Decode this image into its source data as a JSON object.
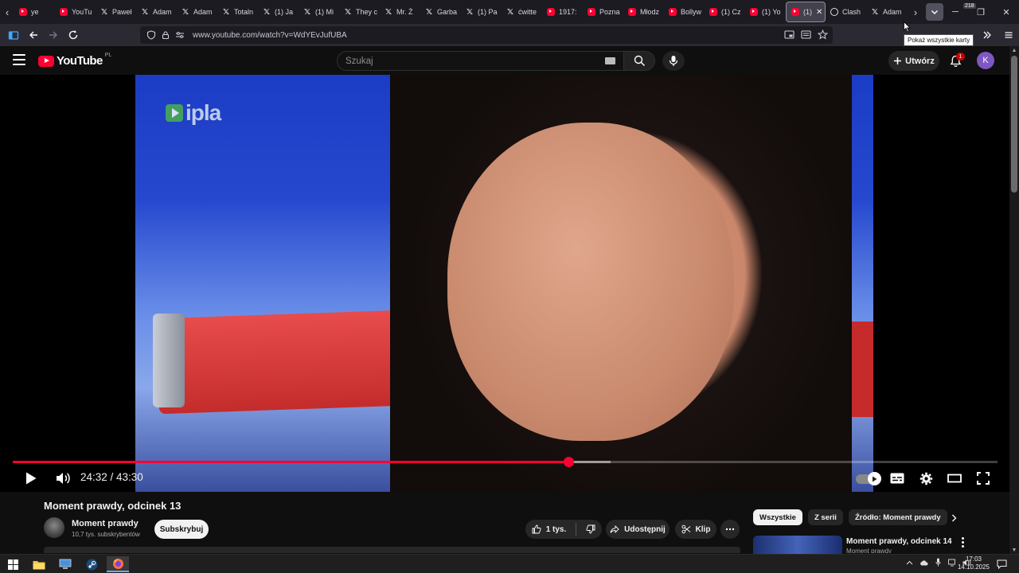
{
  "browser": {
    "tabs": [
      {
        "label": "ye",
        "icon": "youtube-icon"
      },
      {
        "label": "YouTu",
        "icon": "youtube-icon"
      },
      {
        "label": "Paweł",
        "icon": "x-icon"
      },
      {
        "label": "Adam",
        "icon": "x-icon"
      },
      {
        "label": "Adam",
        "icon": "x-icon"
      },
      {
        "label": "Totaln",
        "icon": "x-icon"
      },
      {
        "label": "(1) Ja",
        "icon": "x-icon"
      },
      {
        "label": "(1) Mi",
        "icon": "x-icon"
      },
      {
        "label": "They c",
        "icon": "x-icon"
      },
      {
        "label": "Mr. Ż",
        "icon": "x-icon"
      },
      {
        "label": "Garba",
        "icon": "x-icon"
      },
      {
        "label": "(1) Pa",
        "icon": "x-icon"
      },
      {
        "label": "ćwitte",
        "icon": "x-icon"
      },
      {
        "label": "1917:",
        "icon": "youtube-icon"
      },
      {
        "label": "Pozna",
        "icon": "youtube-icon"
      },
      {
        "label": "Młodz",
        "icon": "youtube-icon"
      },
      {
        "label": "Bollyw",
        "icon": "youtube-icon"
      },
      {
        "label": "(1) Cz",
        "icon": "youtube-icon"
      },
      {
        "label": "(1) Yo",
        "icon": "youtube-icon"
      },
      {
        "label": "(1)",
        "icon": "youtube-icon",
        "active": true
      },
      {
        "label": "Clash",
        "icon": "clash-icon"
      },
      {
        "label": "Adam",
        "icon": "x-icon"
      }
    ],
    "url": "www.youtube.com/watch?v=WdYEvJufUBA",
    "tooltip": "Pokaż wszystkie karty",
    "tab_count_badge": "218"
  },
  "youtube": {
    "logo_text": "YouTube",
    "region": "PL",
    "search_placeholder": "Szukaj",
    "create_label": "Utwórz",
    "notification_count": "1",
    "avatar_letter": "K",
    "player": {
      "current_time": "24:32",
      "duration": "43:30",
      "time_display": "24:32 / 43:30",
      "progress_fraction": 0.564,
      "buffered_fraction": 0.607,
      "watermark": "ipla"
    },
    "video": {
      "title": "Moment prawdy, odcinek 13",
      "channel": "Moment prawdy",
      "subscribers": "10,7 tys. subskrybentów",
      "subscribe_label": "Subskrybuj",
      "likes": "1 tys.",
      "share_label": "Udostępnij",
      "clip_label": "Klip"
    },
    "chips": [
      "Wszystkie",
      "Z serii",
      "Źródło: Moment prawdy"
    ],
    "recommendation": {
      "title": "Moment prawdy, odcinek 14",
      "channel": "Moment prawdy"
    }
  },
  "taskbar": {
    "time": "17:03",
    "date": "14.10.2025"
  },
  "colors": {
    "accent_red": "#ff0033",
    "background": "#0f0f0f"
  }
}
